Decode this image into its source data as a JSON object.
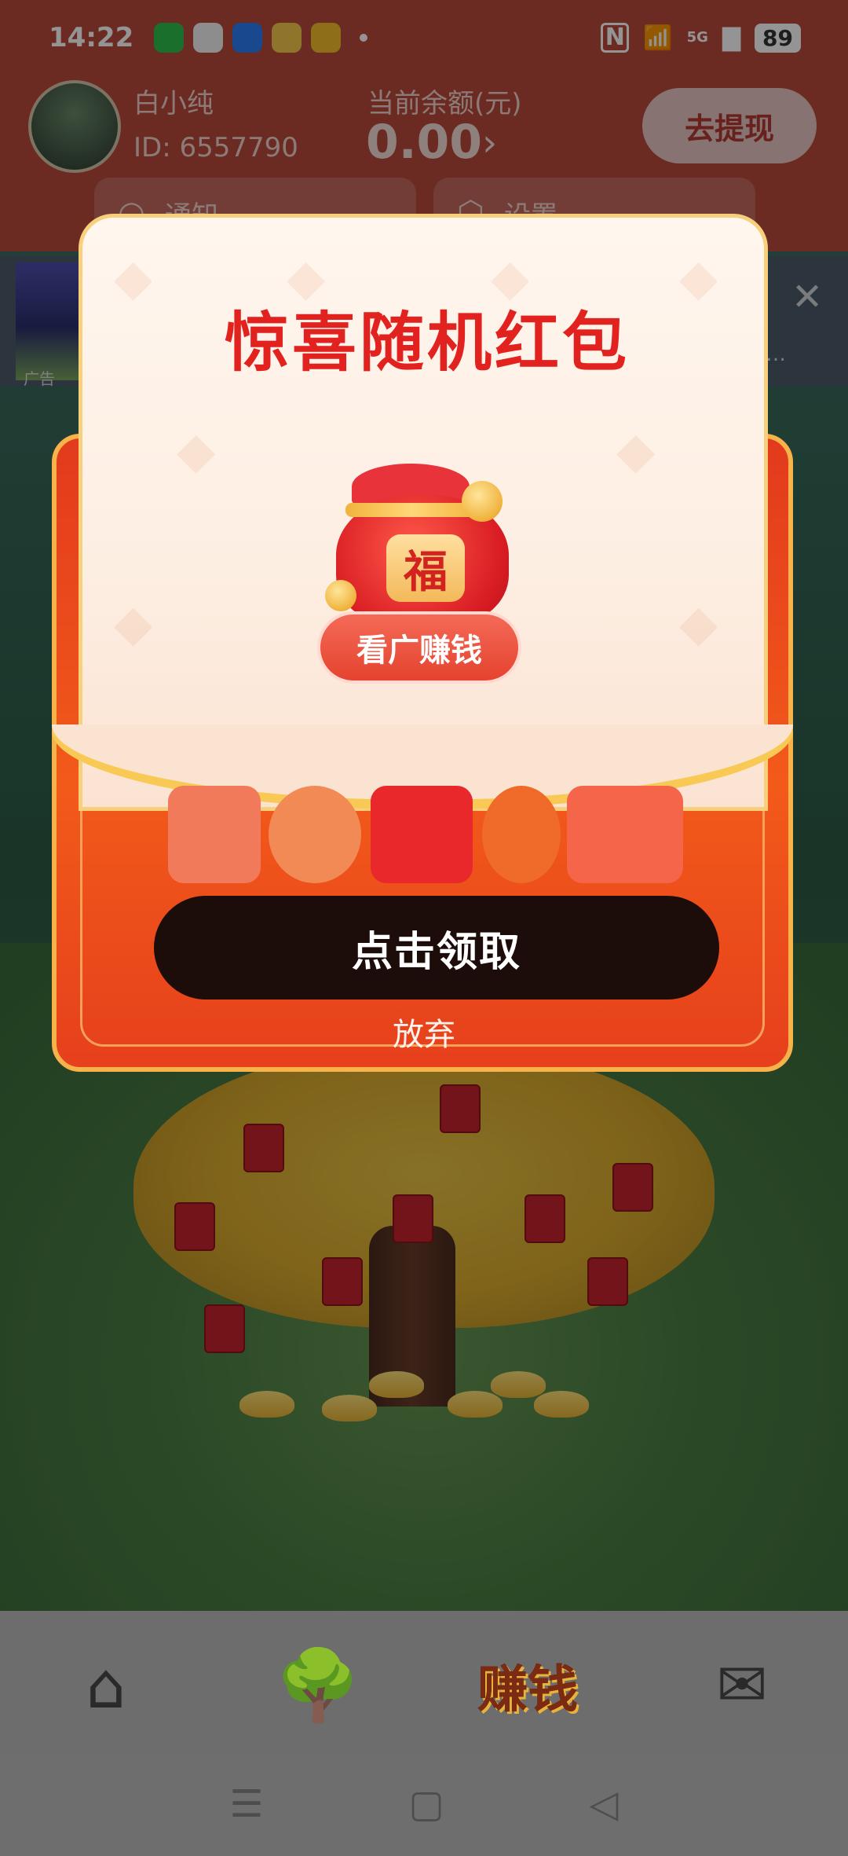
{
  "status_bar": {
    "time": "14:22",
    "network": "5G",
    "battery": "89",
    "app_icons": [
      "wechat-icon",
      "qq-icon",
      "pinwheel-icon",
      "weibo-icon",
      "gift-icon"
    ]
  },
  "header": {
    "username": "白小纯",
    "user_id": "ID: 6557790",
    "balance_label": "当前余额(元)",
    "balance_value": "0.00",
    "withdraw_label": "去提现",
    "notify_label": "通知",
    "settings_label": "设置"
  },
  "ad": {
    "tag": "广告"
  },
  "modal": {
    "title": "惊喜随机红包",
    "badge_char": "福",
    "watch_ad_label": "看广赚钱",
    "claim_label": "点击领取",
    "give_up_label": "放弃"
  },
  "bottom_nav": {
    "earn_label": "赚钱"
  },
  "colors": {
    "accent_red": "#e2221f",
    "modal_orange": "#f25a1a",
    "gold": "#f9c955",
    "claim_button": "#1c0c0a"
  }
}
